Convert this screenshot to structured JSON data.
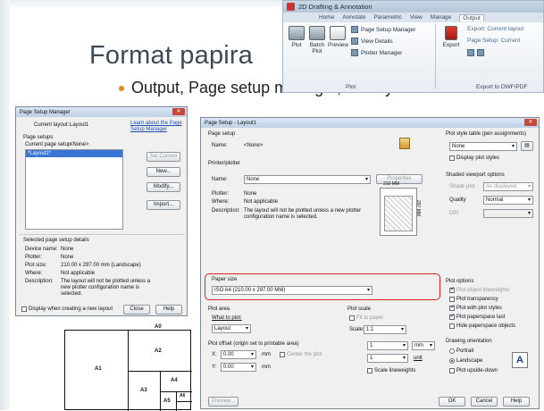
{
  "slide": {
    "title": "Format papira",
    "bullet": "Output, Page setup manager, Modify..."
  },
  "ribbon": {
    "workspace": "2D Drafting & Annotation",
    "tabs": [
      "Home",
      "Annotate",
      "Parametric",
      "View",
      "Manage",
      "Output"
    ],
    "active_tab": "Output",
    "tools": {
      "plot": "Plot",
      "batch_plot": "Batch Plot",
      "preview": "Preview",
      "page_setup_manager": "Page Setup Manager",
      "view_details": "View Details",
      "plotter_manager": "Plotter Manager",
      "export": "Export",
      "export_current_layout": "Export: Current layout",
      "page_setup_current": "Page Setup: Current"
    },
    "panel_plot": "Plot",
    "panel_export": "Export to DWF/PDF"
  },
  "psm": {
    "title": "Page Setup Manager",
    "current_layout_label": "Current layout:",
    "current_layout_value": "Layout1",
    "learn_link": "Learn about the Page Setup Manager",
    "page_setups": "Page setups",
    "current_page_setup": "Current page setup:",
    "current_page_setup_value": "<None>",
    "list_item": "*Layout1*",
    "set_current": "Set Current",
    "new": "New...",
    "modify": "Modify...",
    "import": "Import...",
    "details_heading": "Selected page setup details",
    "device_name_label": "Device name:",
    "device_name_value": "None",
    "plotter_label": "Plotter:",
    "plotter_value": "None",
    "plot_size_label": "Plot size:",
    "plot_size_value": "210.00 x 297.00 mm (Landscape)",
    "where_label": "Where:",
    "where_value": "Not applicable",
    "description_label": "Description:",
    "description_value": "The layout will not be plotted unless a new plotter configuration name is selected.",
    "display_checkbox": "Display when creating a new layout",
    "close": "Close",
    "help": "Help"
  },
  "ps": {
    "title": "Page Setup - Layout1",
    "page_setup": "Page setup",
    "name_label": "Name:",
    "name_value": "<None>",
    "printer_plotter": "Printer/plotter",
    "printer_name_label": "Name:",
    "printer_name_value": "None",
    "properties": "Properties",
    "plotter_label": "Plotter:",
    "plotter_value": "None",
    "where_label": "Where:",
    "where_value": "Not applicable",
    "description_label": "Description:",
    "description_value": "The layout will not be plotted unless a new plotter configuration name is selected.",
    "preview_width": "210 MM",
    "preview_height": "297 MM",
    "paper_size": "Paper size",
    "paper_size_value": "ISO A4 (210.00 x 297.00 MM)",
    "plot_area": "Plot area",
    "what_to_plot": "What to plot:",
    "what_to_plot_value": "Layout",
    "plot_scale": "Plot scale",
    "fit_to_paper": "Fit to paper",
    "scale_label": "Scale:",
    "scale_value": "1:1",
    "plot_offset": "Plot offset (origin set to printable area)",
    "x_label": "X:",
    "x_value": "0.00",
    "y_label": "Y:",
    "y_value": "0.00",
    "unit_mm": "mm",
    "center_plot": "Center the plot",
    "scale_num": "1",
    "scale_den": "1",
    "unit_mm_select": "mm",
    "unit_label": "unit",
    "scale_lineweights": "Scale lineweights",
    "plot_style_table": "Plot style table (pen assignments)",
    "plot_style_value": "None",
    "display_plot_styles": "Display plot styles",
    "shaded_viewport": "Shaded viewport options",
    "shade_plot_label": "Shade plot",
    "shade_plot_value": "As displayed",
    "quality_label": "Quality",
    "quality_value": "Normal",
    "dpi_label": "DPI",
    "plot_options": "Plot options",
    "opt_lineweights": "Plot object lineweights",
    "opt_transparency": "Plot transparency",
    "opt_plot_styles": "Plot with plot styles",
    "opt_paperspace_last": "Plot paperspace last",
    "opt_hide": "Hide paperspace objects",
    "drawing_orientation": "Drawing orientation",
    "portrait": "Portrait",
    "landscape": "Landscape",
    "upside_down": "Plot upside-down",
    "preview_btn": "Preview...",
    "ok": "OK",
    "cancel": "Cancel",
    "help": "Help"
  },
  "sheet": {
    "a0": "A0",
    "a1": "A1",
    "a2": "A2",
    "a3": "A3",
    "a4": "A4",
    "a5": "A5",
    "a6": "A6"
  },
  "colors": {
    "accent": "#e08b1b",
    "highlight": "#d9251d",
    "title": "#3c4a55"
  }
}
